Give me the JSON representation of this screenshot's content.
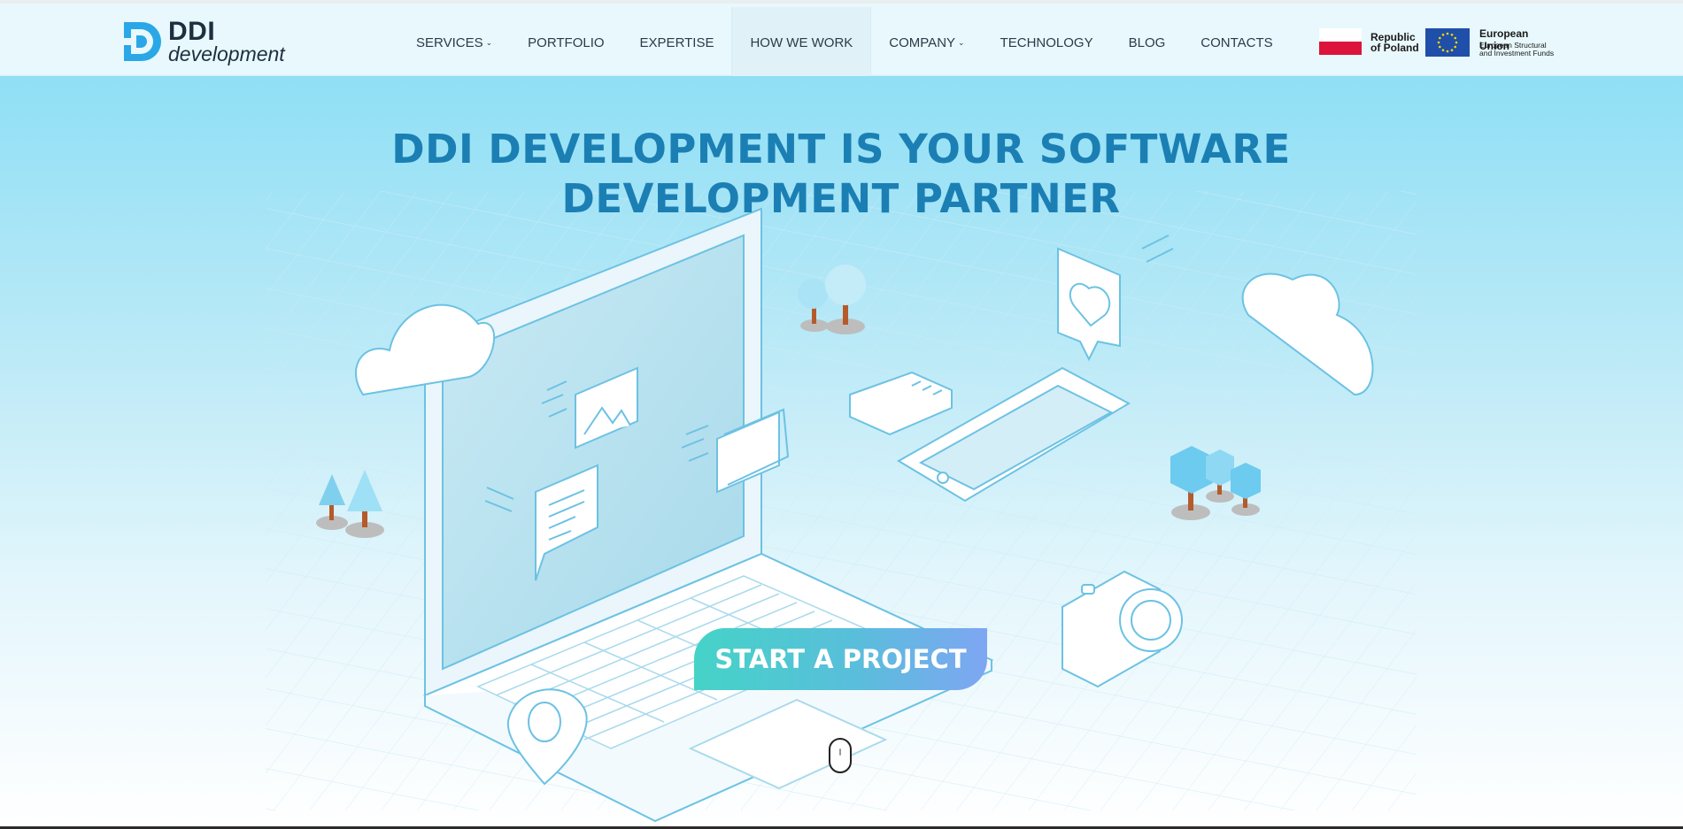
{
  "brand": {
    "logo_main": "DDI",
    "logo_sub": "development",
    "accent_color": "#2aa7e6",
    "text_color": "#1e2f3f"
  },
  "nav": {
    "items": [
      {
        "label": "SERVICES",
        "has_dropdown": true
      },
      {
        "label": "PORTFOLIO",
        "has_dropdown": false
      },
      {
        "label": "EXPERTISE",
        "has_dropdown": false
      },
      {
        "label": "HOW WE WORK",
        "has_dropdown": false,
        "active": true
      },
      {
        "label": "COMPANY",
        "has_dropdown": true
      },
      {
        "label": "TECHNOLOGY",
        "has_dropdown": false
      },
      {
        "label": "BLOG",
        "has_dropdown": false
      },
      {
        "label": "CONTACTS",
        "has_dropdown": false
      }
    ],
    "caret_glyph": "⌄"
  },
  "partners": {
    "poland_line1": "Republic",
    "poland_line2": "of Poland",
    "eu_title": "European Union",
    "eu_line1": "European Structural",
    "eu_line2": "and Investment Funds"
  },
  "hero": {
    "title_line1": "DDI DEVELOPMENT IS YOUR SOFTWARE",
    "title_line2": "DEVELOPMENT PARTNER",
    "title_color": "#1b7fb4",
    "cta_label": "START A PROJECT",
    "cta_gradient": [
      "#45d3c7",
      "#7ea6f3"
    ]
  },
  "icons": [
    "laptop-icon",
    "cloud-icon",
    "tree-icon",
    "image-icon",
    "folder-icon",
    "chat-icon",
    "heart-icon",
    "sd-card-icon",
    "smartphone-icon",
    "camera-icon",
    "map-pin-icon",
    "scroll-mouse-icon"
  ]
}
